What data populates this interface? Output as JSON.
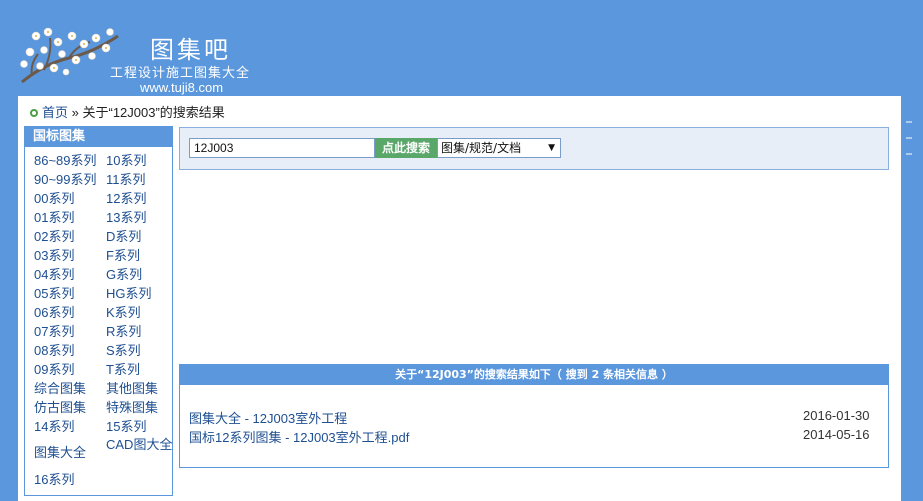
{
  "header": {
    "site_name": "图集吧",
    "slogan": "工程设计施工图集大全",
    "url": "www.tuji8.com"
  },
  "breadcrumb": {
    "home": "首页",
    "separator": "»",
    "current": "关于“12J003”的搜索结果"
  },
  "sidebar": {
    "title": "国标图集",
    "items": [
      "86~89系列",
      "10系列",
      "90~99系列",
      "11系列",
      "00系列",
      "12系列",
      "01系列",
      "13系列",
      "02系列",
      "D系列",
      "03系列",
      "F系列",
      "04系列",
      "G系列",
      "05系列",
      "HG系列",
      "06系列",
      "K系列",
      "07系列",
      "R系列",
      "08系列",
      "S系列",
      "09系列",
      "T系列",
      "综合图集",
      "其他图集",
      "仿古图集",
      "特殊图集",
      "14系列",
      "15系列",
      "图集大全",
      "CAD图大全",
      "16系列"
    ]
  },
  "search": {
    "value": "12J003",
    "button_label": "点此搜索",
    "select_value": "图集/规范/文档"
  },
  "results": {
    "header": "关于“12J003”的搜索结果如下（ 搜到 2 条相关信息 ）",
    "items": [
      {
        "title": "图集大全 - 12J003室外工程",
        "date": "2016-01-30"
      },
      {
        "title": "国标12系列图集 - 12J003室外工程.pdf",
        "date": "2014-05-16"
      }
    ]
  },
  "colors": {
    "background": "#5b97dc",
    "accent_green": "#5aa76a",
    "link": "#1e4f91"
  }
}
